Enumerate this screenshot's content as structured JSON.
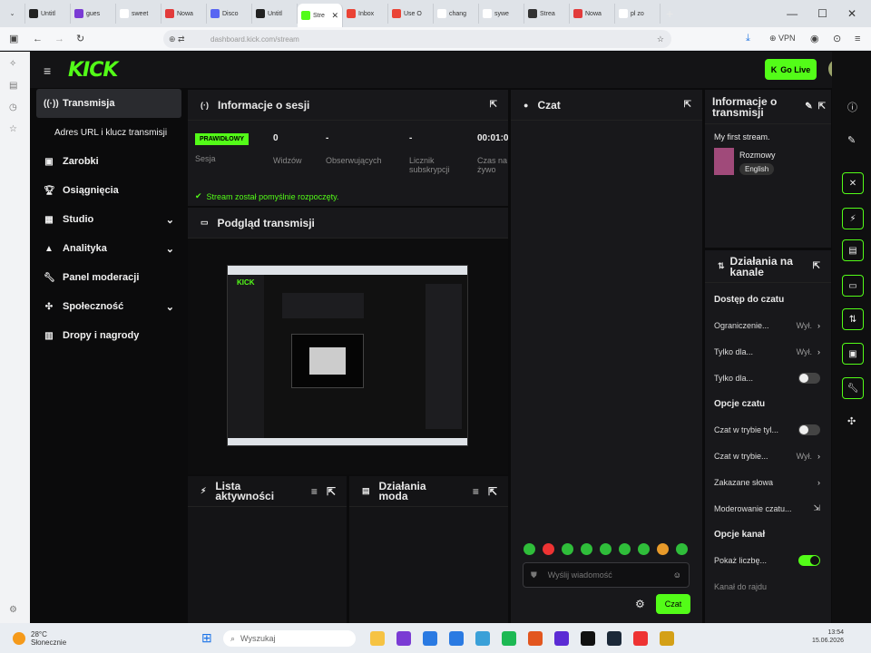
{
  "browser": {
    "tabs": [
      {
        "label": "Untitl",
        "color": "#222"
      },
      {
        "label": "gues",
        "color": "#7a3bd4"
      },
      {
        "label": "sweet",
        "color": "#fff"
      },
      {
        "label": "Nowa",
        "color": "#e23b3b"
      },
      {
        "label": "Disco",
        "color": "#5865f2"
      },
      {
        "label": "Untitl",
        "color": "#222"
      },
      {
        "label": "Stre",
        "color": "#53fc18",
        "active": true
      },
      {
        "label": "Inbox",
        "color": "#ea4335"
      },
      {
        "label": "Use O",
        "color": "#ea4335"
      },
      {
        "label": "chang",
        "color": "#fff"
      },
      {
        "label": "sywe",
        "color": "#fff"
      },
      {
        "label": "Strea",
        "color": "#333"
      },
      {
        "label": "Nowa",
        "color": "#e23b3b"
      },
      {
        "label": "pl zo",
        "color": "#fff"
      }
    ],
    "url": "dashboard.kick.com/stream",
    "vpn_label": "VPN"
  },
  "header": {
    "logo": "KICK",
    "go_live": "Go Live"
  },
  "nav": {
    "transmisja": "Transmisja",
    "adres": "Adres URL i klucz transmisji",
    "zarobki": "Zarobki",
    "osiagniecia": "Osiągnięcia",
    "studio": "Studio",
    "analityka": "Analityka",
    "panel_moderacji": "Panel moderacji",
    "spolecznosc": "Społeczność",
    "dropy": "Dropy i nagrody"
  },
  "session": {
    "title": "Informacje o sesji",
    "badge": "PRAWIDŁOWY",
    "sesja": "Sesja",
    "widzow_value": "0",
    "widzow": "Widzów",
    "obserwujacych_value": "-",
    "obserwujacych": "Obserwujących",
    "licznik_value": "-",
    "licznik": "Licznik subskrypcji",
    "czas_value": "00:01:0",
    "czas": "Czas na żywo",
    "success": "Stream został pomyślnie rozpoczęty."
  },
  "preview": {
    "title": "Podgląd transmisji"
  },
  "activity": {
    "title": "Lista aktywności"
  },
  "mod_actions": {
    "title": "Działania moda"
  },
  "chat": {
    "title": "Czat",
    "placeholder": "Wyślij wiadomość",
    "send": "Czat"
  },
  "stream_info": {
    "title": "Informacje o transmisji",
    "stream_title": "My first stream.",
    "category": "Rozmowy",
    "language": "English"
  },
  "channel_actions": {
    "title": "Działania na kanale",
    "chat_access": "Dostęp do czatu",
    "rows": [
      {
        "label": "Ograniczenie...",
        "value": "Wył."
      },
      {
        "label": "Tylko dla...",
        "value": "Wył."
      }
    ],
    "tylko_dla_toggle": "Tylko dla...",
    "chat_options": "Opcje czatu",
    "czat_w_trybie_1": "Czat w trybie tyl...",
    "czat_w_trybie_2": "Czat w trybie...",
    "czat_w_trybie_2_val": "Wył.",
    "zakazane": "Zakazane słowa",
    "moderowanie": "Moderowanie czatu...",
    "channel_options": "Opcje kanał",
    "pokaz": "Pokaż liczbę...",
    "kanal_do_rajdu": "Kanał do rajdu"
  },
  "taskbar": {
    "weather_temp": "28°C",
    "weather_desc": "Słonecznie",
    "search": "Wyszukaj",
    "time": "13:54",
    "date": "15.06.2026"
  }
}
